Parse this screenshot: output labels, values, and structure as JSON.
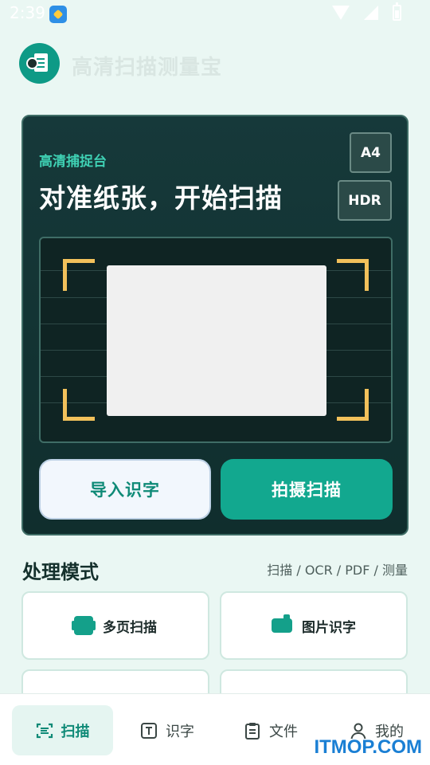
{
  "status_bar": {
    "time": "2:39"
  },
  "header": {
    "title": "高清扫描测量宝"
  },
  "capture": {
    "subtitle": "高清捕捉台",
    "title": "对准纸张，开始扫描",
    "paper_size": "A4",
    "hdr": "HDR",
    "import_label": "导入识字",
    "shoot_label": "拍摄扫描"
  },
  "modes": {
    "title": "处理模式",
    "hint": "扫描 / OCR / PDF / 测量",
    "items": [
      {
        "label": "多页扫描",
        "icon": "pages-icon"
      },
      {
        "label": "图片识字",
        "icon": "image-icon"
      }
    ]
  },
  "nav": {
    "items": [
      {
        "label": "扫描",
        "icon": "scan-icon",
        "active": true
      },
      {
        "label": "识字",
        "icon": "text-icon",
        "active": false
      },
      {
        "label": "文件",
        "icon": "clipboard-icon",
        "active": false
      },
      {
        "label": "我的",
        "icon": "person-icon",
        "active": false
      }
    ]
  },
  "watermark": "ITMOP.COM",
  "colors": {
    "accent": "#12a88f",
    "card": "#16393a",
    "corner": "#f2c15b",
    "background": "#eaf7f3"
  }
}
